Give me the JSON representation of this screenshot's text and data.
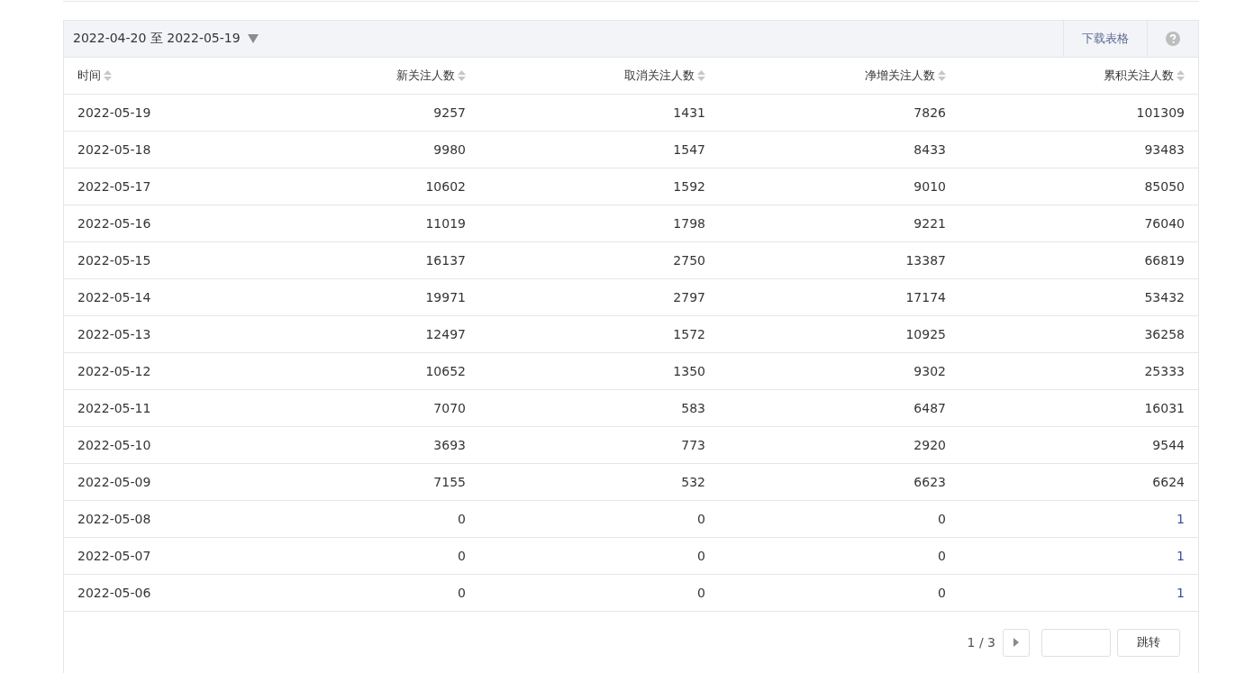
{
  "toolbar": {
    "date_range": "2022-04-20 至 2022-05-19",
    "download": "下载表格"
  },
  "table": {
    "columns": [
      "时间",
      "新关注人数",
      "取消关注人数",
      "净增关注人数",
      "累积关注人数"
    ],
    "rows": [
      {
        "cells": [
          "2022-05-19",
          "9257",
          "1431",
          "7826",
          "101309"
        ],
        "linked": false
      },
      {
        "cells": [
          "2022-05-18",
          "9980",
          "1547",
          "8433",
          "93483"
        ],
        "linked": false
      },
      {
        "cells": [
          "2022-05-17",
          "10602",
          "1592",
          "9010",
          "85050"
        ],
        "linked": false
      },
      {
        "cells": [
          "2022-05-16",
          "11019",
          "1798",
          "9221",
          "76040"
        ],
        "linked": false
      },
      {
        "cells": [
          "2022-05-15",
          "16137",
          "2750",
          "13387",
          "66819"
        ],
        "linked": false
      },
      {
        "cells": [
          "2022-05-14",
          "19971",
          "2797",
          "17174",
          "53432"
        ],
        "linked": false
      },
      {
        "cells": [
          "2022-05-13",
          "12497",
          "1572",
          "10925",
          "36258"
        ],
        "linked": false
      },
      {
        "cells": [
          "2022-05-12",
          "10652",
          "1350",
          "9302",
          "25333"
        ],
        "linked": false
      },
      {
        "cells": [
          "2022-05-11",
          "7070",
          "583",
          "6487",
          "16031"
        ],
        "linked": false
      },
      {
        "cells": [
          "2022-05-10",
          "3693",
          "773",
          "2920",
          "9544"
        ],
        "linked": false
      },
      {
        "cells": [
          "2022-05-09",
          "7155",
          "532",
          "6623",
          "6624"
        ],
        "linked": false
      },
      {
        "cells": [
          "2022-05-08",
          "0",
          "0",
          "0",
          "1"
        ],
        "linked": true
      },
      {
        "cells": [
          "2022-05-07",
          "0",
          "0",
          "0",
          "1"
        ],
        "linked": true
      },
      {
        "cells": [
          "2022-05-06",
          "0",
          "0",
          "0",
          "1"
        ],
        "linked": true
      }
    ]
  },
  "pagination": {
    "page": "1 / 3",
    "jump": "跳转"
  }
}
